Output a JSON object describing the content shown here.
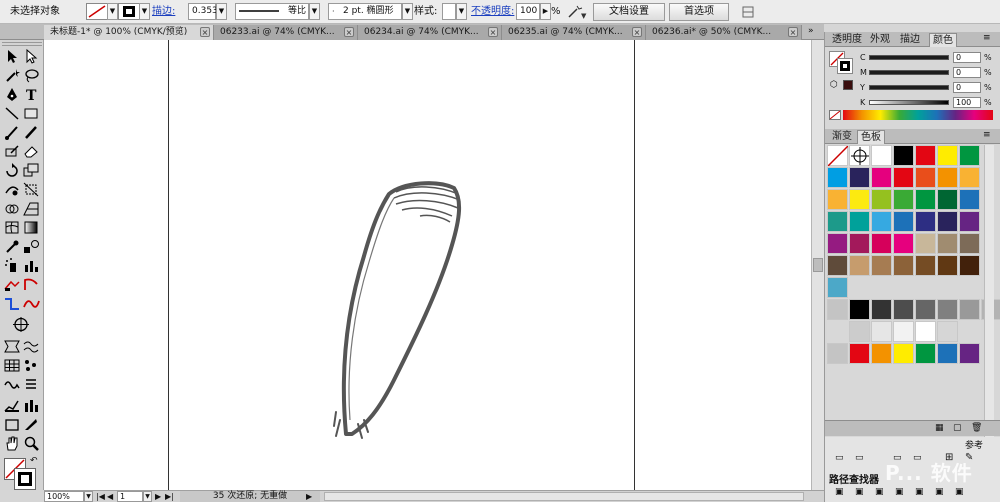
{
  "control_bar": {
    "selection_label": "未选择对象",
    "stroke_link": "描边:",
    "stroke_weight": "0.353",
    "stroke_profile": "等比",
    "brush_size": "2 pt. 椭圆形",
    "style_label": "样式:",
    "opacity_link": "不透明度:",
    "opacity_value": "100",
    "opacity_unit": "%",
    "doc_setup_button": "文档设置",
    "preferences_button": "首选项",
    "stroke_color": "#000000",
    "fill_none_color": "#cc0000"
  },
  "tabs": [
    {
      "label": "未标题-1* @ 100% (CMYK/预览)",
      "active": true
    },
    {
      "label": "06233.ai @ 74% (CMYK...",
      "active": false
    },
    {
      "label": "06234.ai @ 74% (CMYK...",
      "active": false
    },
    {
      "label": "06235.ai @ 74% (CMYK...",
      "active": false
    },
    {
      "label": "06236.ai* @ 50% (CMYK...",
      "active": false
    }
  ],
  "status_bar": {
    "zoom": "100%",
    "page": "1",
    "message": "35 次还原; 无重做"
  },
  "color_panel": {
    "tabs": [
      "透明度",
      "外观",
      "描边",
      "颜色"
    ],
    "active_tab": "颜色",
    "sliders": [
      {
        "label": "C",
        "value": "0",
        "unit": "%"
      },
      {
        "label": "M",
        "value": "0",
        "unit": "%"
      },
      {
        "label": "Y",
        "value": "0",
        "unit": "%"
      },
      {
        "label": "K",
        "value": "100",
        "unit": "%"
      }
    ]
  },
  "swatches_panel": {
    "tabs": [
      "渐变",
      "色板"
    ],
    "active_tab": "色板",
    "rows": [
      [
        "#ffffff",
        "#ffffff",
        "#ffffff",
        "#000000",
        "#e30613",
        "#ffec00",
        "#009640"
      ],
      [
        "#009ee3",
        "#29235c",
        "#e5007e",
        "#e30613",
        "#e94e1b",
        "#f39200",
        "#f9b233"
      ],
      [
        "#f9b233",
        "#fcea10",
        "#95c11f",
        "#3aaa35",
        "#009640",
        "#006633",
        "#1d71b8"
      ],
      [
        "#1d9a8a",
        "#00a19a",
        "#36a9e1",
        "#1d71b8",
        "#2d2e83",
        "#29235c",
        "#662483"
      ],
      [
        "#951b81",
        "#a3195b",
        "#d6005b",
        "#e6007e",
        "#c8b79a",
        "#a08c70",
        "#7d6b58"
      ],
      [
        "#5f4b3a",
        "#c69c6d",
        "#a67c52",
        "#8c6239",
        "#754c24",
        "#603813",
        "#42210b"
      ]
    ],
    "gray_row": [
      "#000000",
      "#333333",
      "#4d4d4d",
      "#666666",
      "#808080",
      "#999999",
      "#b3b3b3"
    ],
    "light_row": [
      "#cccccc",
      "#e6e6e6",
      "#f2f2f2",
      "#ffffff",
      "#d6d6d6"
    ],
    "bright_row": [
      "#e30613",
      "#f39200",
      "#ffec00",
      "#009640",
      "#1d71b8",
      "#662483"
    ],
    "standalone": "#4ca8c8"
  },
  "brush_panel": {
    "title": "路径查找器"
  },
  "watermark": "P... 软件"
}
